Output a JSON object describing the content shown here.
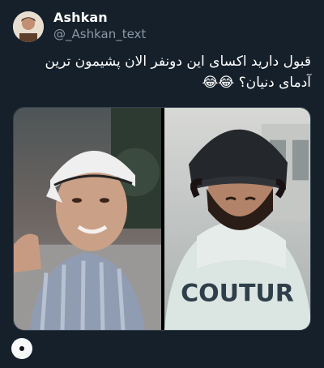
{
  "tweet": {
    "author_name": "Ashkan",
    "author_handle": "@_Ashkan_text",
    "text": "قبول دارید اکسای این دونفر الان پشیمون ترین آدمای دنیان؟",
    "emoji": "😂😂"
  },
  "media": {
    "count": 2,
    "left_photo_icon": "person-photo",
    "right_photo_icon": "person-photo",
    "right_photo_text": "COUTUR"
  },
  "footer": {
    "menu_icon": "more-dot-icon"
  },
  "colors": {
    "background": "#15202b",
    "secondary_text": "#8b98a5",
    "border": "#38444d"
  }
}
